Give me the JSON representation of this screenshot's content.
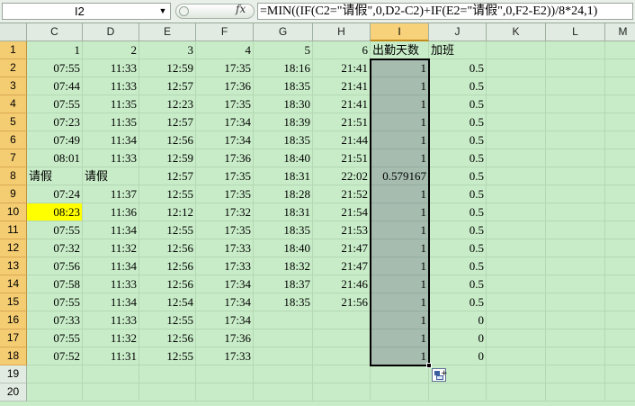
{
  "formula_bar": {
    "name_box": "I2",
    "fx_label": "fx",
    "formula": "=MIN((IF(C2=\"请假\",0,D2-C2)+IF(E2=\"请假\",0,F2-E2))/8*24,1)"
  },
  "sheet": {
    "columns": [
      "C",
      "D",
      "E",
      "F",
      "G",
      "H",
      "I",
      "J",
      "K",
      "L",
      "M"
    ],
    "active_column": "I",
    "rows": [
      {
        "num": "1",
        "cells": [
          "1",
          "2",
          "3",
          "4",
          "5",
          "6",
          "出勤天数",
          "加班",
          "",
          "",
          ""
        ]
      },
      {
        "num": "2",
        "cells": [
          "07:55",
          "11:33",
          "12:59",
          "17:35",
          "18:16",
          "21:41",
          "1",
          "0.5",
          "",
          "",
          ""
        ]
      },
      {
        "num": "3",
        "cells": [
          "07:44",
          "11:33",
          "12:57",
          "17:36",
          "18:35",
          "21:41",
          "1",
          "0.5",
          "",
          "",
          ""
        ]
      },
      {
        "num": "4",
        "cells": [
          "07:55",
          "11:35",
          "12:23",
          "17:35",
          "18:30",
          "21:41",
          "1",
          "0.5",
          "",
          "",
          ""
        ]
      },
      {
        "num": "5",
        "cells": [
          "07:23",
          "11:35",
          "12:57",
          "17:34",
          "18:39",
          "21:51",
          "1",
          "0.5",
          "",
          "",
          ""
        ]
      },
      {
        "num": "6",
        "cells": [
          "07:49",
          "11:34",
          "12:56",
          "17:34",
          "18:35",
          "21:44",
          "1",
          "0.5",
          "",
          "",
          ""
        ]
      },
      {
        "num": "7",
        "cells": [
          "08:01",
          "11:33",
          "12:59",
          "17:36",
          "18:40",
          "21:51",
          "1",
          "0.5",
          "",
          "",
          ""
        ]
      },
      {
        "num": "8",
        "cells": [
          "请假",
          "请假",
          "12:57",
          "17:35",
          "18:31",
          "22:02",
          "0.579167",
          "0.5",
          "",
          "",
          ""
        ]
      },
      {
        "num": "9",
        "cells": [
          "07:24",
          "11:37",
          "12:55",
          "17:35",
          "18:28",
          "21:52",
          "1",
          "0.5",
          "",
          "",
          ""
        ]
      },
      {
        "num": "10",
        "cells": [
          "08:23",
          "11:36",
          "12:12",
          "17:32",
          "18:31",
          "21:54",
          "1",
          "0.5",
          "",
          "",
          ""
        ]
      },
      {
        "num": "11",
        "cells": [
          "07:55",
          "11:34",
          "12:55",
          "17:35",
          "18:35",
          "21:53",
          "1",
          "0.5",
          "",
          "",
          ""
        ]
      },
      {
        "num": "12",
        "cells": [
          "07:32",
          "11:32",
          "12:56",
          "17:33",
          "18:40",
          "21:47",
          "1",
          "0.5",
          "",
          "",
          ""
        ]
      },
      {
        "num": "13",
        "cells": [
          "07:56",
          "11:34",
          "12:56",
          "17:33",
          "18:32",
          "21:47",
          "1",
          "0.5",
          "",
          "",
          ""
        ]
      },
      {
        "num": "14",
        "cells": [
          "07:58",
          "11:33",
          "12:56",
          "17:34",
          "18:37",
          "21:46",
          "1",
          "0.5",
          "",
          "",
          ""
        ]
      },
      {
        "num": "15",
        "cells": [
          "07:55",
          "11:34",
          "12:54",
          "17:34",
          "18:35",
          "21:56",
          "1",
          "0.5",
          "",
          "",
          ""
        ]
      },
      {
        "num": "16",
        "cells": [
          "07:33",
          "11:33",
          "12:55",
          "17:34",
          "",
          "",
          "1",
          "0",
          "",
          "",
          ""
        ]
      },
      {
        "num": "17",
        "cells": [
          "07:55",
          "11:32",
          "12:56",
          "17:36",
          "",
          "",
          "1",
          "0",
          "",
          "",
          ""
        ]
      },
      {
        "num": "18",
        "cells": [
          "07:52",
          "11:31",
          "12:55",
          "17:33",
          "",
          "",
          "1",
          "0",
          "",
          "",
          ""
        ]
      },
      {
        "num": "19",
        "cells": [
          "",
          "",
          "",
          "",
          "",
          "",
          "",
          "",
          "",
          "",
          ""
        ]
      },
      {
        "num": "20",
        "cells": [
          "",
          "",
          "",
          "",
          "",
          "",
          "",
          "",
          "",
          "",
          ""
        ]
      }
    ]
  },
  "highlight_color": "#ffff00",
  "selection_color": "#a5bcaf"
}
